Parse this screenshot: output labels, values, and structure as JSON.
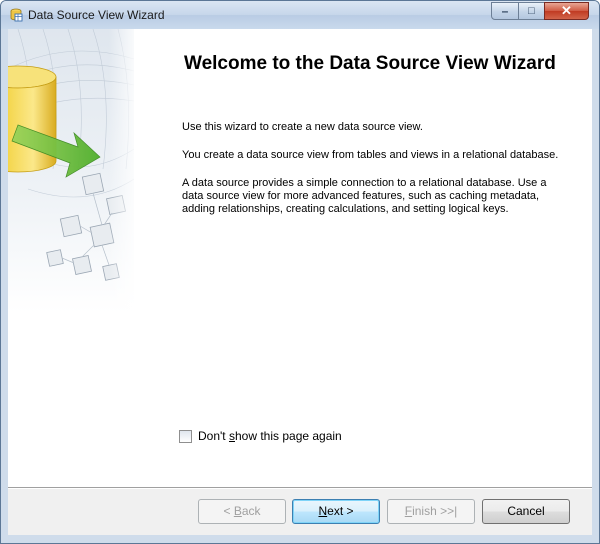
{
  "window": {
    "title": "Data Source View Wizard",
    "controls": {
      "minimize": "–",
      "maximize": "□",
      "close": "✕"
    }
  },
  "page": {
    "heading": "Welcome to the Data Source View Wizard",
    "paragraphs": [
      "Use this wizard to create a new data source view.",
      "You create a data source view from tables and views in a relational database.",
      "A data source provides a simple connection to a relational database. Use a data source view for more advanced features, such as caching metadata, adding relationships, creating calculations, and setting logical keys."
    ],
    "checkbox": {
      "label_before": "Don't ",
      "label_mnemonic": "s",
      "label_after": "how this page again",
      "checked": false
    }
  },
  "buttons": {
    "back": {
      "before": "< ",
      "mnemonic": "B",
      "after": "ack",
      "enabled": false
    },
    "next": {
      "before": "",
      "mnemonic": "N",
      "after": "ext >",
      "enabled": true,
      "default": true
    },
    "finish": {
      "before": "",
      "mnemonic": "F",
      "after": "inish >>|",
      "enabled": false
    },
    "cancel": {
      "label": "Cancel",
      "enabled": true
    }
  },
  "icons": {
    "app": "data-source-view-icon",
    "side_art": "database-cylinder-arrow-graphic"
  },
  "colors": {
    "titlebar": "#c6d6ea",
    "close_button": "#c03a22",
    "default_button_border": "#3c7fb1",
    "bottom_panel": "#f0f0f0"
  }
}
